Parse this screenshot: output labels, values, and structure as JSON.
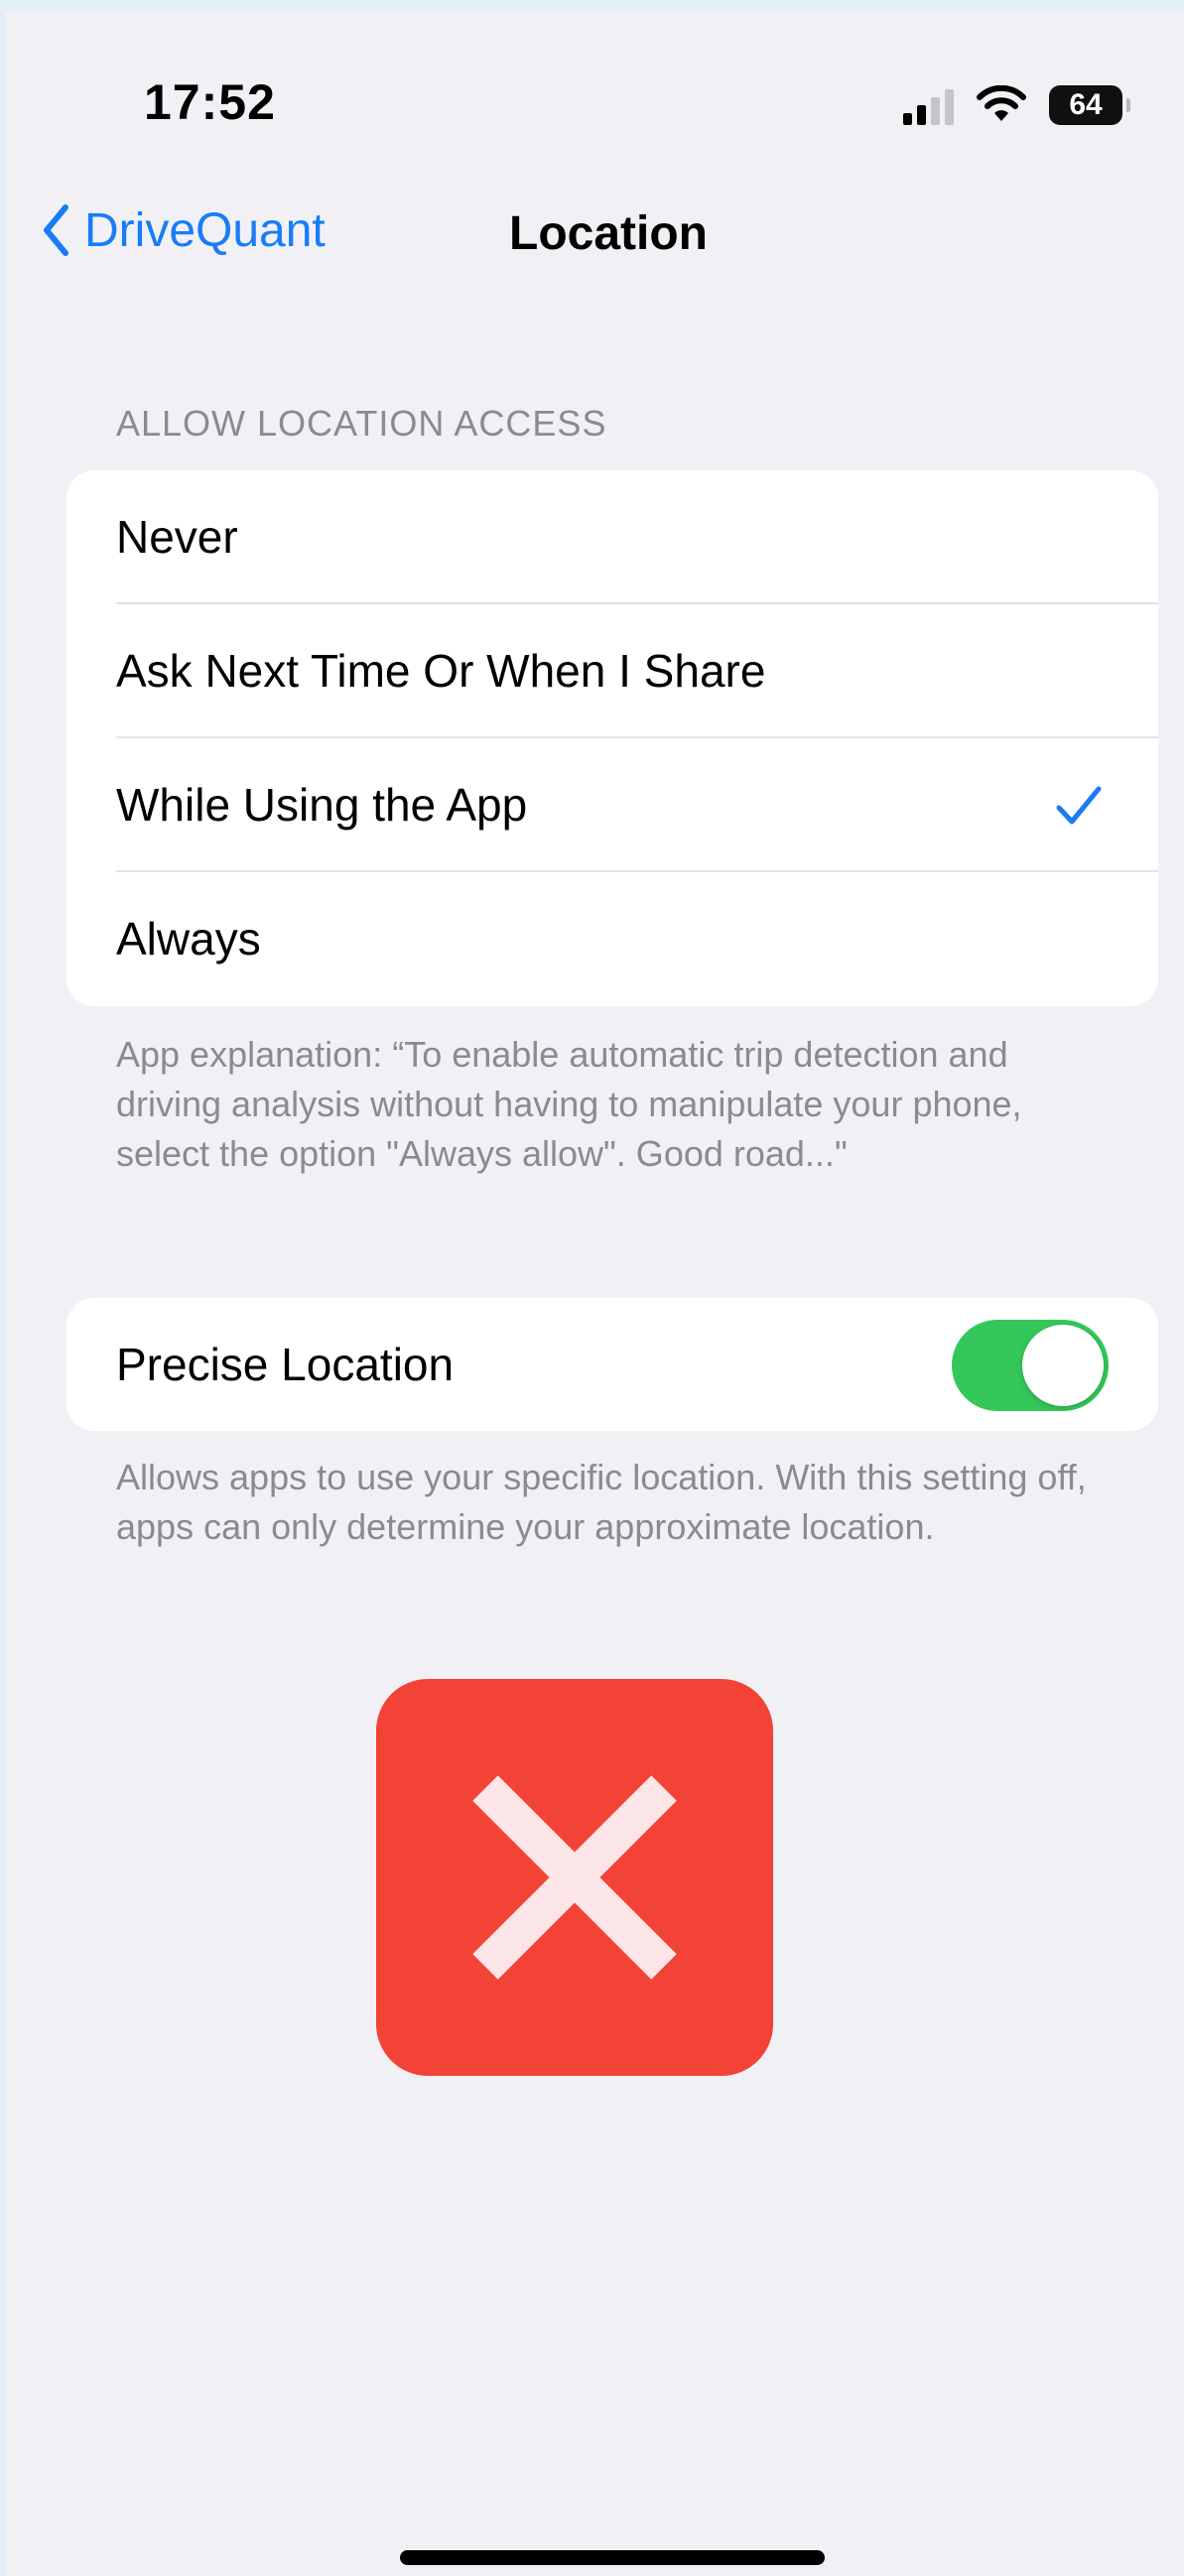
{
  "status_bar": {
    "time": "17:52",
    "battery": "64"
  },
  "nav": {
    "back_label": "DriveQuant",
    "title": "Location"
  },
  "access_section": {
    "header": "ALLOW LOCATION ACCESS",
    "options": [
      {
        "label": "Never",
        "selected": false
      },
      {
        "label": "Ask Next Time Or When I Share",
        "selected": false
      },
      {
        "label": "While Using the App",
        "selected": true
      },
      {
        "label": "Always",
        "selected": false
      }
    ],
    "footnote": "App explanation: “To enable automatic trip detection and driving analysis without having to manipulate your phone, select the option \"Always allow\". Good road...\""
  },
  "precise_section": {
    "label": "Precise Location",
    "enabled": true,
    "footnote": "Allows apps to use your specific location. With this setting off, apps can only determine your approximate location."
  },
  "colors": {
    "accent": "#1a7cf5",
    "toggle_on": "#34c759",
    "deny_badge": "#f34336",
    "background": "#f1f1f5"
  },
  "icons": {
    "back": "chevron-left-icon",
    "check": "checkmark-icon",
    "deny": "x-mark-icon",
    "wifi": "wifi-icon",
    "signal": "cellular-signal-icon",
    "battery": "battery-icon"
  }
}
